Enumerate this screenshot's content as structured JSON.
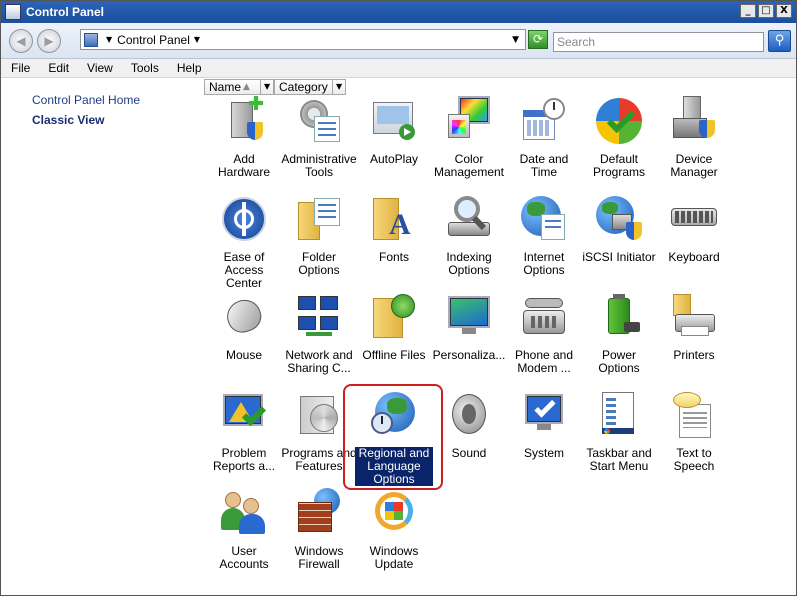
{
  "window": {
    "title": "Control Panel",
    "buttons": {
      "minimize": "_",
      "maximize": "□",
      "close": "X"
    }
  },
  "address": {
    "path": "Control Panel",
    "search_placeholder": "Search"
  },
  "menu": [
    "File",
    "Edit",
    "View",
    "Tools",
    "Help"
  ],
  "sidebar": {
    "home_link": "Control Panel Home",
    "classic_view": "Classic View"
  },
  "columns": {
    "name": "Name",
    "category": "Category"
  },
  "items": [
    {
      "label": "Add Hardware",
      "icon": "add-hardware-icon"
    },
    {
      "label": "Administrative Tools",
      "icon": "administrative-tools-icon"
    },
    {
      "label": "AutoPlay",
      "icon": "autoplay-icon"
    },
    {
      "label": "Color Management",
      "icon": "color-management-icon"
    },
    {
      "label": "Date and Time",
      "icon": "date-time-icon"
    },
    {
      "label": "Default Programs",
      "icon": "default-programs-icon"
    },
    {
      "label": "Device Manager",
      "icon": "device-manager-icon"
    },
    {
      "label": "Ease of Access Center",
      "icon": "ease-of-access-icon"
    },
    {
      "label": "Folder Options",
      "icon": "folder-options-icon"
    },
    {
      "label": "Fonts",
      "icon": "fonts-icon"
    },
    {
      "label": "Indexing Options",
      "icon": "indexing-options-icon"
    },
    {
      "label": "Internet Options",
      "icon": "internet-options-icon"
    },
    {
      "label": "iSCSI Initiator",
      "icon": "iscsi-initiator-icon"
    },
    {
      "label": "Keyboard",
      "icon": "keyboard-icon"
    },
    {
      "label": "Mouse",
      "icon": "mouse-icon"
    },
    {
      "label": "Network and Sharing C...",
      "icon": "network-sharing-icon"
    },
    {
      "label": "Offline Files",
      "icon": "offline-files-icon"
    },
    {
      "label": "Personaliza...",
      "icon": "personalization-icon"
    },
    {
      "label": "Phone and Modem ...",
      "icon": "phone-modem-icon"
    },
    {
      "label": "Power Options",
      "icon": "power-options-icon"
    },
    {
      "label": "Printers",
      "icon": "printers-icon"
    },
    {
      "label": "Problem Reports a...",
      "icon": "problem-reports-icon"
    },
    {
      "label": "Programs and Features",
      "icon": "programs-features-icon"
    },
    {
      "label": "Regional and Language Options",
      "icon": "regional-language-icon",
      "selected": true
    },
    {
      "label": "Sound",
      "icon": "sound-icon"
    },
    {
      "label": "System",
      "icon": "system-icon"
    },
    {
      "label": "Taskbar and Start Menu",
      "icon": "taskbar-start-icon"
    },
    {
      "label": "Text to Speech",
      "icon": "text-to-speech-icon"
    },
    {
      "label": "User Accounts",
      "icon": "user-accounts-icon"
    },
    {
      "label": "Windows Firewall",
      "icon": "windows-firewall-icon"
    },
    {
      "label": "Windows Update",
      "icon": "windows-update-icon"
    }
  ],
  "colors": {
    "titlebar": "#1c4f9c",
    "selection": "#0a246a",
    "highlight_outline": "#cc2020",
    "link": "#1f3d86"
  }
}
